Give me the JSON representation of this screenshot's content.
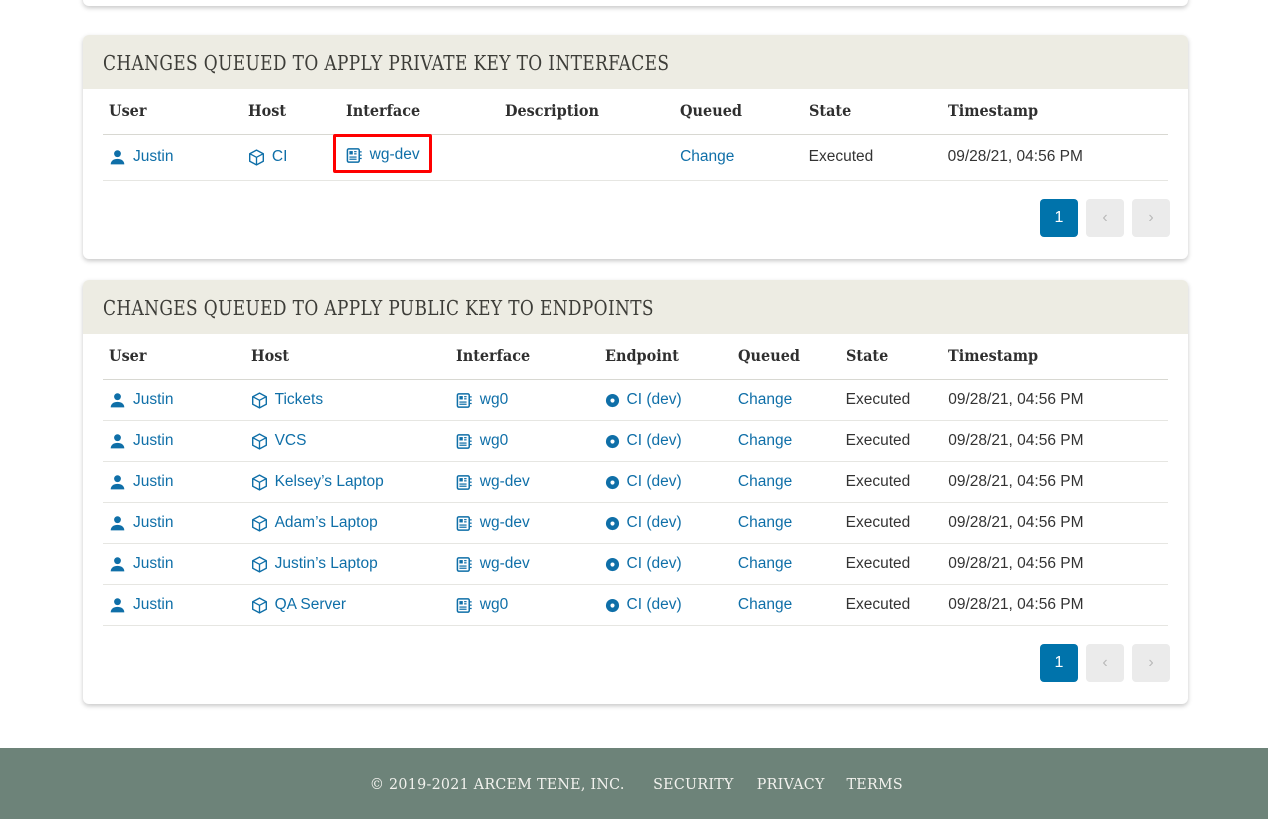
{
  "page": {
    "background": "#ffffff",
    "accent_blue": "#0073ab",
    "link_blue": "#0f6fa8",
    "header_bg": "#edece3",
    "footer_bg": "#6d8379",
    "highlight_color": "#ff0000"
  },
  "cards": [
    {
      "id": "private-key-interfaces",
      "title": "Changes queued to apply private key to interfaces",
      "columns": [
        "User",
        "Host",
        "Interface",
        "Description",
        "Queued",
        "State",
        "Timestamp"
      ],
      "rows": [
        {
          "user": "Justin",
          "host": "CI",
          "interface": "wg-dev",
          "description": "",
          "queued": "Change",
          "state": "Executed",
          "timestamp": "09/28/21, 04:56 PM",
          "highlighted": "interface"
        }
      ],
      "pagination": {
        "current": "1",
        "prev": "‹",
        "next": "›"
      }
    },
    {
      "id": "public-key-endpoints",
      "title": "Changes queued to apply public key to endpoints",
      "columns": [
        "User",
        "Host",
        "Interface",
        "Endpoint",
        "Queued",
        "State",
        "Timestamp"
      ],
      "rows": [
        {
          "user": "Justin",
          "host": "Tickets",
          "interface": "wg0",
          "endpoint": "CI (dev)",
          "queued": "Change",
          "state": "Executed",
          "timestamp": "09/28/21, 04:56 PM"
        },
        {
          "user": "Justin",
          "host": "VCS",
          "interface": "wg0",
          "endpoint": "CI (dev)",
          "queued": "Change",
          "state": "Executed",
          "timestamp": "09/28/21, 04:56 PM"
        },
        {
          "user": "Justin",
          "host": "Kelsey’s Laptop",
          "interface": "wg-dev",
          "endpoint": "CI (dev)",
          "queued": "Change",
          "state": "Executed",
          "timestamp": "09/28/21, 04:56 PM"
        },
        {
          "user": "Justin",
          "host": "Adam’s Laptop",
          "interface": "wg-dev",
          "endpoint": "CI (dev)",
          "queued": "Change",
          "state": "Executed",
          "timestamp": "09/28/21, 04:56 PM"
        },
        {
          "user": "Justin",
          "host": "Justin’s Laptop",
          "interface": "wg-dev",
          "endpoint": "CI (dev)",
          "queued": "Change",
          "state": "Executed",
          "timestamp": "09/28/21, 04:56 PM"
        },
        {
          "user": "Justin",
          "host": "QA Server",
          "interface": "wg0",
          "endpoint": "CI (dev)",
          "queued": "Change",
          "state": "Executed",
          "timestamp": "09/28/21, 04:56 PM"
        }
      ],
      "pagination": {
        "current": "1",
        "prev": "‹",
        "next": "›"
      }
    }
  ],
  "icons": {
    "user": "user-icon",
    "host": "cube-icon",
    "interface": "interface-card-icon",
    "endpoint": "endpoint-dot-icon"
  },
  "footer": {
    "copyright": "© 2019-2021 Arcem Tene, Inc.",
    "links": [
      "Security",
      "Privacy",
      "Terms"
    ]
  }
}
